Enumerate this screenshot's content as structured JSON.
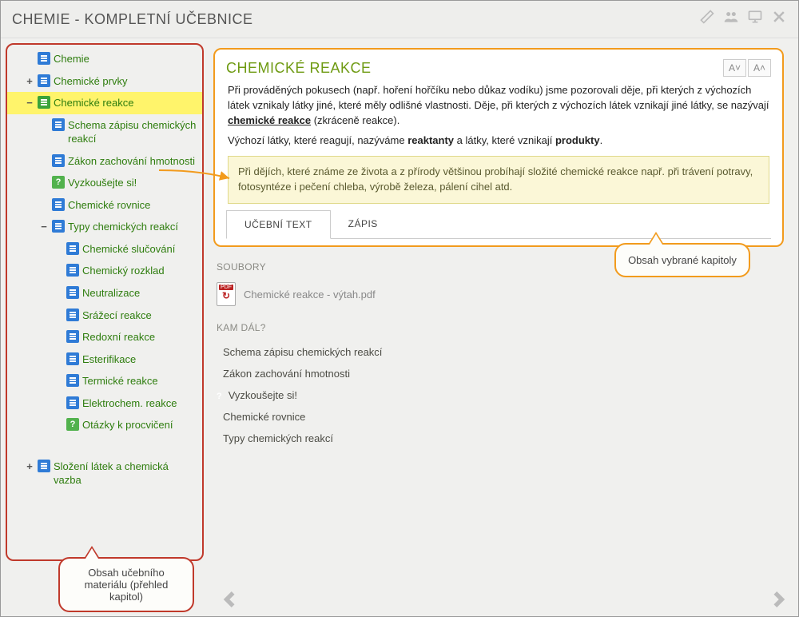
{
  "header": {
    "title": "CHEMIE - KOMPLETNÍ UČEBNICE"
  },
  "sidebar": {
    "items": [
      {
        "label": "Chemie",
        "toggle": "",
        "iconClass": "page-icon",
        "indent": 1,
        "selected": false
      },
      {
        "label": "Chemické prvky",
        "toggle": "+",
        "iconClass": "page-icon",
        "indent": 1,
        "selected": false
      },
      {
        "label": "Chemické reakce",
        "toggle": "−",
        "iconClass": "page-icon green",
        "indent": 1,
        "selected": true
      },
      {
        "label": "Schema zápisu chemických reakcí",
        "toggle": "",
        "iconClass": "page-icon",
        "indent": 2,
        "selected": false
      },
      {
        "label": "Zákon zachování hmotnosti",
        "toggle": "",
        "iconClass": "page-icon",
        "indent": 2,
        "selected": false
      },
      {
        "label": "Vyzkoušejte si!",
        "toggle": "",
        "iconClass": "page-icon help",
        "indent": 2,
        "selected": false
      },
      {
        "label": "Chemické rovnice",
        "toggle": "",
        "iconClass": "page-icon",
        "indent": 2,
        "selected": false
      },
      {
        "label": "Typy chemických reakcí",
        "toggle": "−",
        "iconClass": "page-icon",
        "indent": 2,
        "selected": false
      },
      {
        "label": "Chemické slučování",
        "toggle": "",
        "iconClass": "page-icon",
        "indent": 3,
        "selected": false
      },
      {
        "label": "Chemický rozklad",
        "toggle": "",
        "iconClass": "page-icon",
        "indent": 3,
        "selected": false
      },
      {
        "label": "Neutralizace",
        "toggle": "",
        "iconClass": "page-icon",
        "indent": 3,
        "selected": false
      },
      {
        "label": "Srážecí reakce",
        "toggle": "",
        "iconClass": "page-icon",
        "indent": 3,
        "selected": false
      },
      {
        "label": "Redoxní reakce",
        "toggle": "",
        "iconClass": "page-icon",
        "indent": 3,
        "selected": false
      },
      {
        "label": "Esterifikace",
        "toggle": "",
        "iconClass": "page-icon",
        "indent": 3,
        "selected": false
      },
      {
        "label": "Termické reakce",
        "toggle": "",
        "iconClass": "page-icon",
        "indent": 3,
        "selected": false
      },
      {
        "label": "Elektrochem. reakce",
        "toggle": "",
        "iconClass": "page-icon",
        "indent": 3,
        "selected": false
      },
      {
        "label": "Otázky k procvičení",
        "toggle": "",
        "iconClass": "page-icon help",
        "indent": 3,
        "selected": false
      },
      {
        "label": "Složení látek a chemická vazba",
        "toggle": "+",
        "iconClass": "page-icon",
        "indent": 1,
        "selected": false
      }
    ]
  },
  "content": {
    "title": "CHEMICKÉ REAKCE",
    "fontSmall": "A˅",
    "fontLarge": "A˄",
    "para1_a": "Při prováděných pokusech (např. hoření hořčíku nebo důkaz vodíku) jsme pozorovali děje, při kterých z výchozích látek vznikaly látky jiné, které měly odlišné vlastnosti. Děje, při kterých z výchozích látek vznikají jiné látky, se nazývají ",
    "para1_b": "chemické reakce",
    "para1_c": " (zkráceně reakce).",
    "para2_a": "Výchozí látky, které reagují, nazýváme ",
    "para2_b": "reaktanty",
    "para2_c": " a látky, které vznikají ",
    "para2_d": "produkty",
    "para2_e": ".",
    "note": "Při dějích, které známe ze života a z přírody většinou probíhají složité chemické reakce např. při trávení potravy, fotosyntéze i pečení chleba, výrobě železa, pálení cihel atd.",
    "tabs": {
      "t1": "UČEBNÍ TEXT",
      "t2": "ZÁPIS"
    },
    "files_label": "SOUBORY",
    "file1": "Chemické reakce - výtah.pdf",
    "next_label": "KAM DÁL?",
    "links": [
      {
        "label": "Schema zápisu chemických reakcí",
        "iconClass": "page-icon"
      },
      {
        "label": "Zákon zachování hmotnosti",
        "iconClass": "page-icon"
      },
      {
        "label": "Vyzkoušejte si!",
        "iconClass": "page-icon help"
      },
      {
        "label": "Chemické rovnice",
        "iconClass": "page-icon"
      },
      {
        "label": "Typy chemických reakcí",
        "iconClass": "page-icon"
      }
    ]
  },
  "callouts": {
    "red": "Obsah učebního materiálu (přehled kapitol)",
    "orange": "Obsah vybrané kapitoly"
  }
}
